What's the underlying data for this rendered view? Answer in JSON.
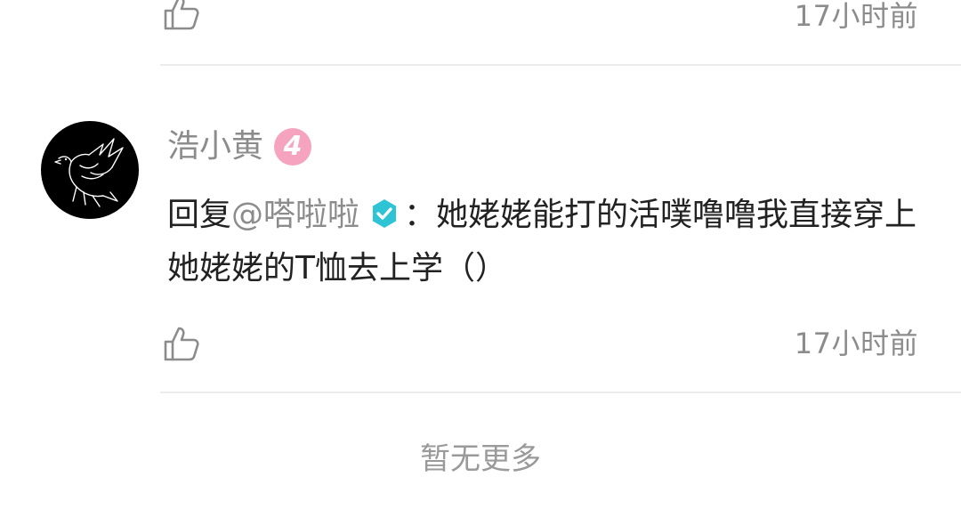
{
  "previous_comment": {
    "like_icon": "thumbs-up-icon",
    "time": "17小时前"
  },
  "comment": {
    "avatar_icon": "bird-avatar",
    "username": "浩小黄",
    "level": "4",
    "reply_prefix": "回复",
    "mention": "@嗒啦啦",
    "verified_icon": "verified-check-icon",
    "separator": "：",
    "text": "她姥姥能打的活噗噜噜我直接穿上她姥姥的T恤去上学（）",
    "like_icon": "thumbs-up-icon",
    "time": "17小时前"
  },
  "footer": {
    "no_more": "暂无更多"
  },
  "colors": {
    "secondary_text": "#8c8c8c",
    "level_badge": "#f5a3be",
    "verified_badge": "#2ec4d6",
    "divider": "#ececec"
  }
}
